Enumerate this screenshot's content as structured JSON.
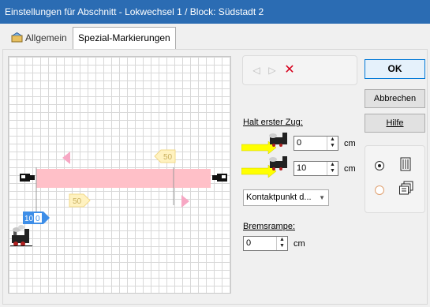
{
  "window": {
    "title": "Einstellungen für Abschnitt - Lokwechsel 1 / Block: Südstadt 2"
  },
  "tabs": [
    {
      "label": "Allgemein",
      "active": false
    },
    {
      "label": "Spezial-Markierungen",
      "active": true
    }
  ],
  "nav": {
    "prev_icon": "triangle-left-icon",
    "next_icon": "triangle-right-icon",
    "delete_icon": "red-x-icon"
  },
  "buttons": {
    "ok": "OK",
    "cancel": "Abbrechen",
    "help": "Hilfe"
  },
  "halt": {
    "label": "Halt erster Zug:",
    "row1": {
      "value": "0",
      "unit": "cm"
    },
    "row2": {
      "value": "10",
      "unit": "cm"
    }
  },
  "kontakt": {
    "selected": "Kontaktpunkt d..."
  },
  "brems": {
    "label": "Bremsrampe:",
    "value": "0",
    "unit": "cm"
  },
  "diagram": {
    "marker_top_label": "50",
    "marker_bottom_label": "50",
    "blue_marker_label": "10",
    "blue_marker_value": "0"
  },
  "colors": {
    "accent": "#2b6cb3",
    "track": "#ffc0c8",
    "marker_pink": "#f7a8c4",
    "marker_yellow": "#fff2c0",
    "blue_marker": "#3d8ee8",
    "arrow_yellow": "#ffff00"
  }
}
